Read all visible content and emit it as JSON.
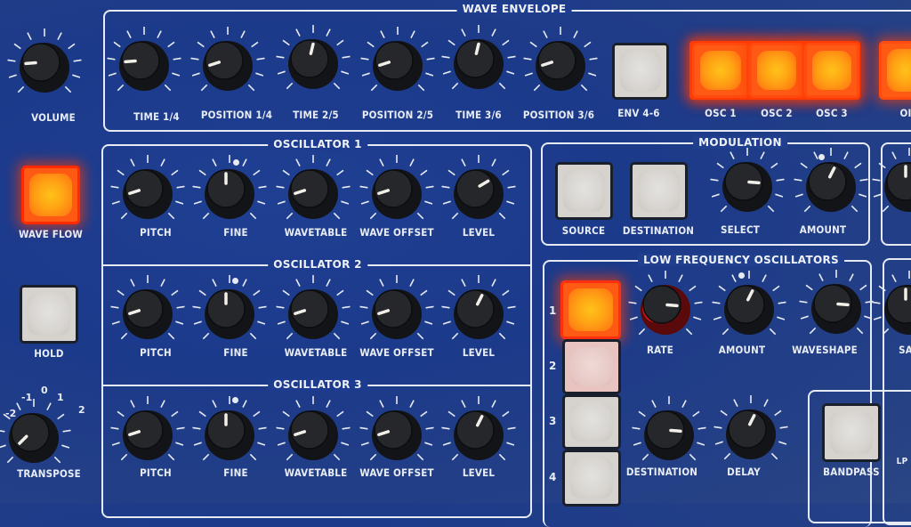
{
  "panel": {
    "left_controls": {
      "volume": {
        "label": "VOLUME",
        "value": 0.15
      },
      "wave_flow": {
        "label": "WAVE FLOW",
        "lit": true
      },
      "hold": {
        "label": "HOLD",
        "lit": false
      },
      "transpose": {
        "label": "TRANSPOSE",
        "scale": [
          "-2",
          "-1",
          "0",
          "1",
          "2"
        ],
        "value": "-2"
      }
    },
    "wave_envelope": {
      "title": "WAVE ENVELOPE",
      "knobs": [
        {
          "label": "TIME 1/4",
          "value": 0.15
        },
        {
          "label": "POSITION 1/4",
          "value": 0.1
        },
        {
          "label": "TIME 2/5",
          "value": 0.55
        },
        {
          "label": "POSITION 2/5",
          "value": 0.1
        },
        {
          "label": "TIME 3/6",
          "value": 0.55
        },
        {
          "label": "POSITION 3/6",
          "value": 0.1
        }
      ],
      "buttons": [
        {
          "label": "ENV 4-6",
          "lit": false
        },
        {
          "label": "OSC 1",
          "lit": true
        },
        {
          "label": "OSC 2",
          "lit": true
        },
        {
          "label": "OSC 3",
          "lit": true
        },
        {
          "label": "OI",
          "lit": true
        }
      ]
    },
    "oscillators": [
      {
        "title": "OSCILLATOR 1",
        "knobs": [
          {
            "label": "PITCH",
            "value": 0.1
          },
          {
            "label": "FINE",
            "value": 0.5
          },
          {
            "label": "WAVETABLE",
            "value": 0.1
          },
          {
            "label": "WAVE OFFSET",
            "value": 0.1
          },
          {
            "label": "LEVEL",
            "value": 0.72
          }
        ]
      },
      {
        "title": "OSCILLATOR 2",
        "knobs": [
          {
            "label": "PITCH",
            "value": 0.1
          },
          {
            "label": "FINE",
            "value": 0.5
          },
          {
            "label": "WAVETABLE",
            "value": 0.1
          },
          {
            "label": "WAVE OFFSET",
            "value": 0.1
          },
          {
            "label": "LEVEL",
            "value": 0.6
          }
        ]
      },
      {
        "title": "OSCILLATOR 3",
        "knobs": [
          {
            "label": "PITCH",
            "value": 0.1
          },
          {
            "label": "FINE",
            "value": 0.5
          },
          {
            "label": "WAVETABLE",
            "value": 0.1
          },
          {
            "label": "WAVE OFFSET",
            "value": 0.1
          },
          {
            "label": "LEVEL",
            "value": 0.6
          }
        ]
      }
    ],
    "modulation": {
      "title": "MODULATION",
      "buttons": [
        {
          "label": "SOURCE",
          "lit": false
        },
        {
          "label": "DESTINATION",
          "lit": false
        }
      ],
      "knobs": [
        {
          "label": "SELECT",
          "value": 0.85
        },
        {
          "label": "AMOUNT",
          "value": 0.6
        }
      ]
    },
    "lfo": {
      "title": "LOW FREQUENCY OSCILLATORS",
      "selector": [
        {
          "number": "1",
          "lit": true
        },
        {
          "number": "2",
          "lit": false
        },
        {
          "number": "3",
          "lit": false
        },
        {
          "number": "4",
          "lit": false
        }
      ],
      "knobs": [
        {
          "label": "RATE",
          "value": 0.85
        },
        {
          "label": "AMOUNT",
          "value": 0.6
        },
        {
          "label": "WAVESHAPE",
          "value": 0.85
        },
        {
          "label": "DESTINATION",
          "value": 0.85
        },
        {
          "label": "DELAY",
          "value": 0.6
        }
      ]
    },
    "filter": {
      "buttons": [
        {
          "label": "BANDPASS",
          "lit": false
        }
      ],
      "partial_labels": [
        "SA",
        "LP"
      ]
    }
  }
}
